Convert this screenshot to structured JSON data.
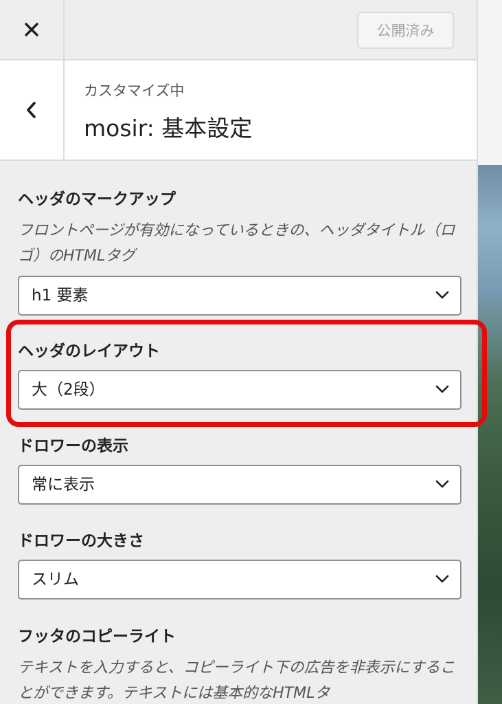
{
  "topbar": {
    "publish_label": "公開済み"
  },
  "header": {
    "subtitle": "カスタマイズ中",
    "title": "mosir: 基本設定"
  },
  "controls": {
    "markup": {
      "title": "ヘッダのマークアップ",
      "desc": "フロントページが有効になっているときの、ヘッダタイトル（ロゴ）のHTMLタグ",
      "value": "h1 要素"
    },
    "layout": {
      "title": "ヘッダのレイアウト",
      "value": "大（2段）"
    },
    "drawer_display": {
      "title": "ドロワーの表示",
      "value": "常に表示"
    },
    "drawer_size": {
      "title": "ドロワーの大きさ",
      "value": "スリム"
    },
    "footer_copyright": {
      "title": "フッタのコピーライト",
      "desc": "テキストを入力すると、コピーライト下の広告を非表示にすることができます。テキストには基本的なHTMLタ"
    }
  },
  "colors": {
    "highlight": "#e50b0b"
  },
  "icons": {
    "close": "close-icon",
    "back": "chevron-left-icon",
    "dropdown": "chevron-down-icon"
  }
}
